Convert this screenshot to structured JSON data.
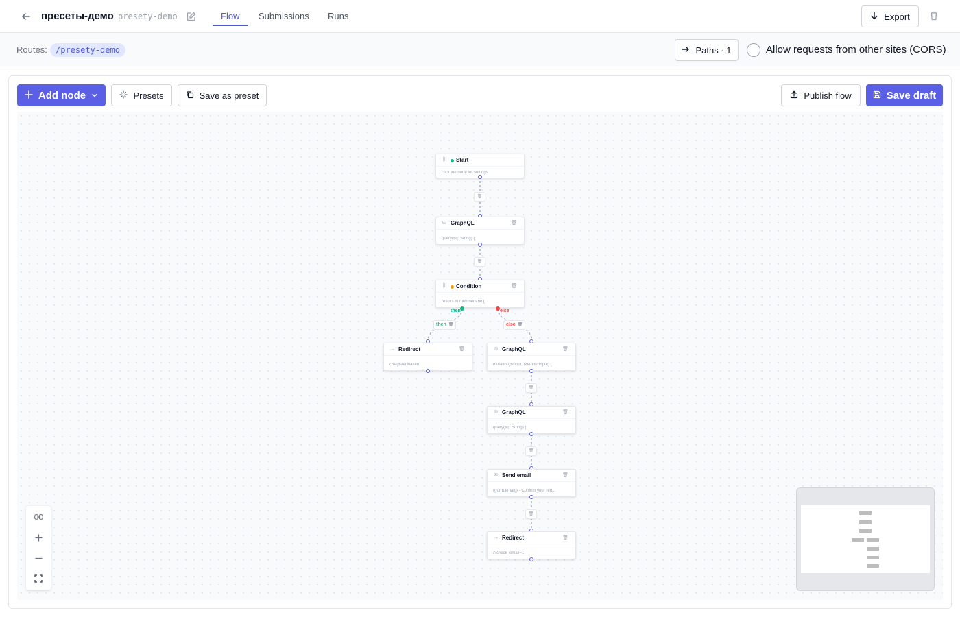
{
  "header": {
    "title": "пресеты-демо",
    "slug": "presety-demo",
    "tabs": [
      {
        "label": "Flow",
        "active": true
      },
      {
        "label": "Submissions",
        "active": false
      },
      {
        "label": "Runs",
        "active": false
      }
    ],
    "export_label": "Export"
  },
  "routes": {
    "label": "Routes:",
    "path": "/presety-demo",
    "paths_label": "Paths · 1",
    "cors_label": "Allow requests from other sites (CORS)",
    "cors_checked": false
  },
  "toolbar": {
    "add_node_label": "Add node",
    "presets_label": "Presets",
    "save_preset_label": "Save as preset",
    "publish_label": "Publish flow",
    "save_draft_label": "Save draft"
  },
  "colors": {
    "accent": "#5b5fe6",
    "then": "#10b981",
    "else": "#ef4444",
    "start_dot": "#10b981",
    "condition_dot": "#f59e0b"
  },
  "flow": {
    "nodes": [
      {
        "id": "start",
        "title": "Start",
        "icon": "drag-handle-icon",
        "subtitle": "click the node for settings"
      },
      {
        "id": "graphql1",
        "title": "GraphQL",
        "icon": "database-icon",
        "subtitle": "query($q: String) {"
      },
      {
        "id": "condition",
        "title": "Condition",
        "icon": "drag-handle-icon",
        "subtitle": "results.m.members ne []"
      },
      {
        "id": "redirect1",
        "title": "Redirect",
        "icon": "arrow-right-icon",
        "subtitle": "/?register=taken"
      },
      {
        "id": "graphql2",
        "title": "GraphQL",
        "icon": "database-icon",
        "subtitle": "mutation($input: MemberInput) {"
      },
      {
        "id": "graphql3",
        "title": "GraphQL",
        "icon": "database-icon",
        "subtitle": "query($q: String) {"
      },
      {
        "id": "sendemail",
        "title": "Send email",
        "icon": "mail-icon",
        "subtitle": "{{form.email}}   ·   Confirm your reg..."
      },
      {
        "id": "redirect2",
        "title": "Redirect",
        "icon": "arrow-right-icon",
        "subtitle": "/?check_email=1"
      }
    ],
    "branches": {
      "then": "then",
      "else": "else"
    }
  }
}
